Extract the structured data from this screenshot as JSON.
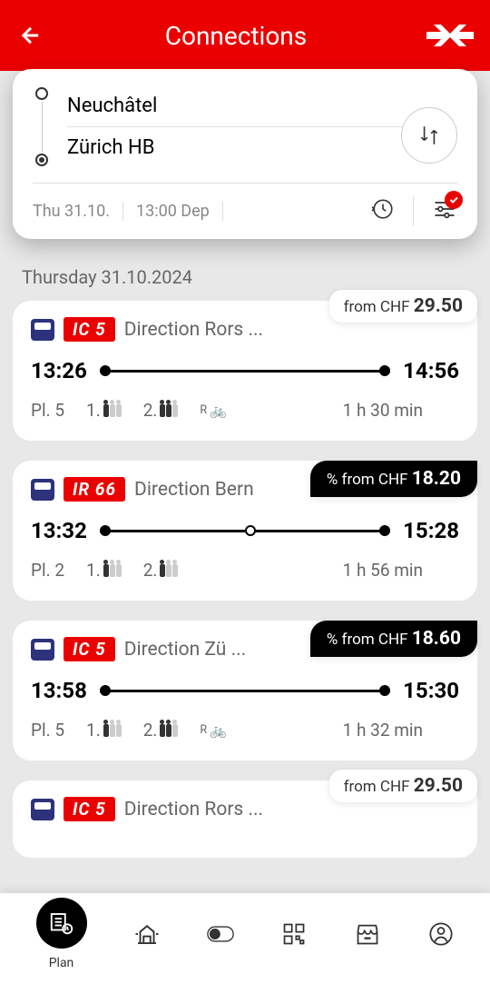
{
  "header": {
    "title": "Connections"
  },
  "search": {
    "from": "Neuchâtel",
    "to": "Zürich HB",
    "date": "Thu 31.10.",
    "time": "13:00 Dep"
  },
  "date_header": "Thursday 31.10.2024",
  "connections": [
    {
      "line": "IC 5",
      "direction": "Direction Rors ...",
      "dep": "13:26",
      "arr": "14:56",
      "platform": "Pl. 5",
      "class1": "1.",
      "class2": "2.",
      "bike": "R",
      "duration": "1 h 30 min",
      "price_prefix": "from CHF ",
      "price": "29.50",
      "price_dark": false,
      "has_stop": false
    },
    {
      "line": "IR 66",
      "direction": "Direction Bern",
      "dep": "13:32",
      "arr": "15:28",
      "platform": "Pl. 2",
      "class1": "1.",
      "class2": "2.",
      "bike": "",
      "duration": "1 h 56 min",
      "price_prefix": "% from CHF ",
      "price": "18.20",
      "price_dark": true,
      "has_stop": true
    },
    {
      "line": "IC 5",
      "direction": "Direction Zü ...",
      "dep": "13:58",
      "arr": "15:30",
      "platform": "Pl. 5",
      "class1": "1.",
      "class2": "2.",
      "bike": "R",
      "duration": "1 h 32 min",
      "price_prefix": "% from CHF ",
      "price": "18.60",
      "price_dark": true,
      "has_stop": false
    },
    {
      "line": "IC 5",
      "direction": "Direction Rors ...",
      "dep": "",
      "arr": "",
      "platform": "",
      "class1": "",
      "class2": "",
      "bike": "",
      "duration": "",
      "price_prefix": "from CHF ",
      "price": "29.50",
      "price_dark": false,
      "has_stop": false
    }
  ],
  "nav": {
    "plan": "Plan"
  }
}
